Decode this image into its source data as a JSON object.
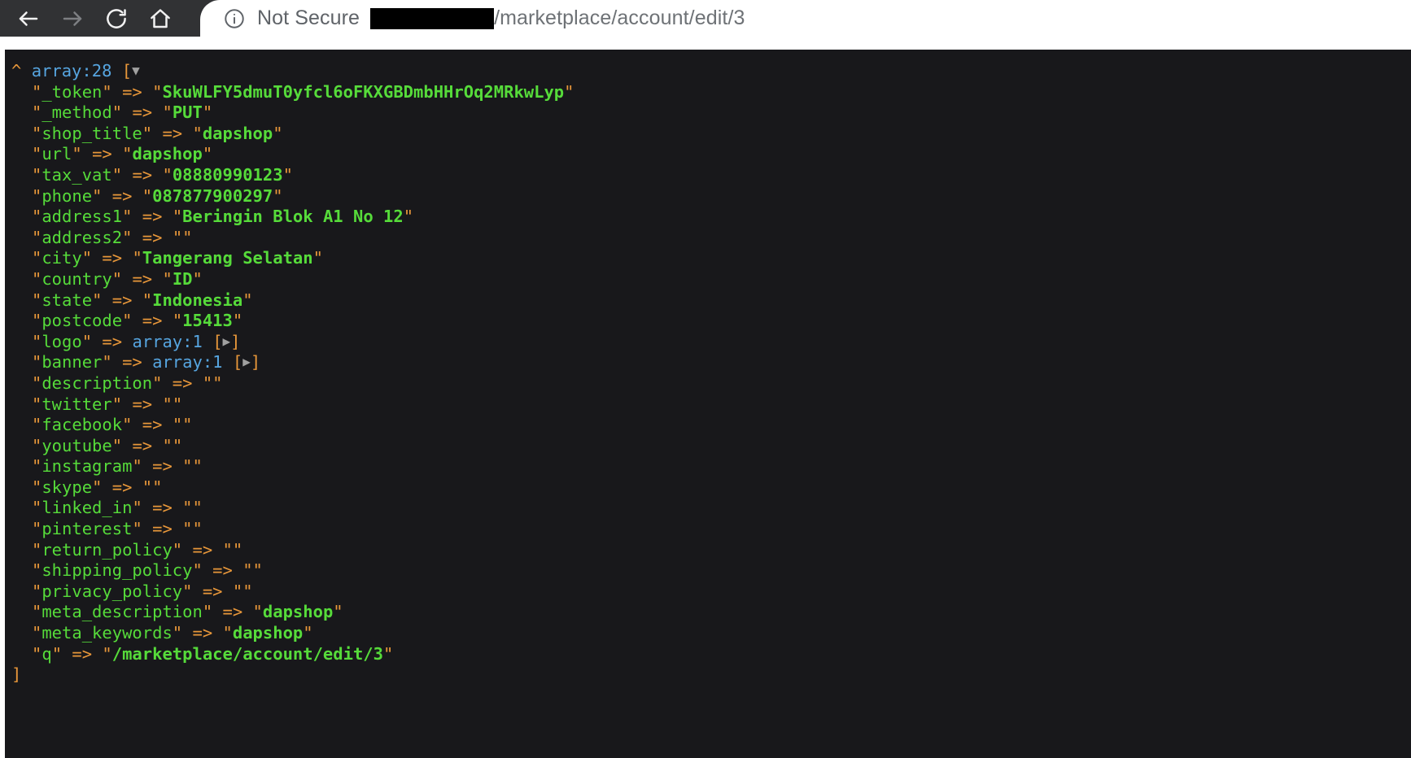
{
  "browser": {
    "nav": [
      {
        "name": "back-button",
        "icon": "arrow-left-icon",
        "enabled": true
      },
      {
        "name": "forward-button",
        "icon": "arrow-right-icon",
        "enabled": false
      },
      {
        "name": "reload-button",
        "icon": "reload-icon",
        "enabled": true
      },
      {
        "name": "home-button",
        "icon": "home-icon",
        "enabled": true
      }
    ],
    "omnibox": {
      "security_icon": "info-circle-icon",
      "security_label": "Not Secure",
      "url_redacted": true,
      "url_text": "/marketplace/account/edit/3"
    }
  },
  "dump": {
    "header": {
      "caret": "^",
      "type": "array:28",
      "open_bracket": "[",
      "toggle": "▼"
    },
    "footer": "]",
    "entries": [
      {
        "key": "_token",
        "arrow": "=>",
        "kind": "string",
        "value": "SkuWLFY5dmuT0yfcl6oFKXGBDmbHHrOq2MRkwLyp"
      },
      {
        "key": "_method",
        "arrow": "=>",
        "kind": "string",
        "value": "PUT"
      },
      {
        "key": "shop_title",
        "arrow": "=>",
        "kind": "string",
        "value": "dapshop"
      },
      {
        "key": "url",
        "arrow": "=>",
        "kind": "string",
        "value": "dapshop"
      },
      {
        "key": "tax_vat",
        "arrow": "=>",
        "kind": "string",
        "value": "08880990123"
      },
      {
        "key": "phone",
        "arrow": "=>",
        "kind": "string",
        "value": "087877900297"
      },
      {
        "key": "address1",
        "arrow": "=>",
        "kind": "string",
        "value": "Beringin Blok A1 No 12"
      },
      {
        "key": "address2",
        "arrow": "=>",
        "kind": "string",
        "value": ""
      },
      {
        "key": "city",
        "arrow": "=>",
        "kind": "string",
        "value": "Tangerang Selatan"
      },
      {
        "key": "country",
        "arrow": "=>",
        "kind": "string",
        "value": "ID"
      },
      {
        "key": "state",
        "arrow": "=>",
        "kind": "string",
        "value": "Indonesia"
      },
      {
        "key": "postcode",
        "arrow": "=>",
        "kind": "string",
        "value": "15413"
      },
      {
        "key": "logo",
        "arrow": "=>",
        "kind": "array",
        "value": "array:1",
        "toggle": "▶"
      },
      {
        "key": "banner",
        "arrow": "=>",
        "kind": "array",
        "value": "array:1",
        "toggle": "▶"
      },
      {
        "key": "description",
        "arrow": "=>",
        "kind": "string",
        "value": ""
      },
      {
        "key": "twitter",
        "arrow": "=>",
        "kind": "string",
        "value": ""
      },
      {
        "key": "facebook",
        "arrow": "=>",
        "kind": "string",
        "value": ""
      },
      {
        "key": "youtube",
        "arrow": "=>",
        "kind": "string",
        "value": ""
      },
      {
        "key": "instagram",
        "arrow": "=>",
        "kind": "string",
        "value": ""
      },
      {
        "key": "skype",
        "arrow": "=>",
        "kind": "string",
        "value": ""
      },
      {
        "key": "linked_in",
        "arrow": "=>",
        "kind": "string",
        "value": ""
      },
      {
        "key": "pinterest",
        "arrow": "=>",
        "kind": "string",
        "value": ""
      },
      {
        "key": "return_policy",
        "arrow": "=>",
        "kind": "string",
        "value": ""
      },
      {
        "key": "shipping_policy",
        "arrow": "=>",
        "kind": "string",
        "value": ""
      },
      {
        "key": "privacy_policy",
        "arrow": "=>",
        "kind": "string",
        "value": ""
      },
      {
        "key": "meta_description",
        "arrow": "=>",
        "kind": "string",
        "value": "dapshop"
      },
      {
        "key": "meta_keywords",
        "arrow": "=>",
        "kind": "string",
        "value": "dapshop"
      },
      {
        "key": "q",
        "arrow": "=>",
        "kind": "string",
        "value": "/marketplace/account/edit/3"
      }
    ]
  },
  "colors": {
    "chrome_bg": "#313234",
    "dump_bg": "#18181b",
    "key_green": "#56db3a",
    "punct_orange": "#e8973a",
    "type_blue": "#56a5e0"
  }
}
